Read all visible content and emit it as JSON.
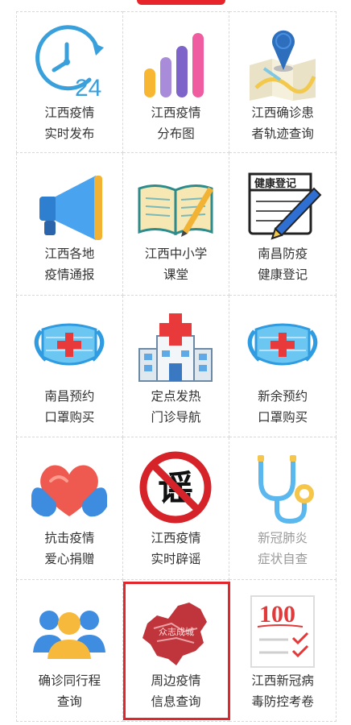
{
  "accent_color": "#e3262b",
  "tiles": [
    {
      "icon": "clock-24-icon",
      "line1": "江西疫情",
      "line2": "实时发布"
    },
    {
      "icon": "bar-chart-icon",
      "line1": "江西疫情",
      "line2": "分布图"
    },
    {
      "icon": "map-pin-icon",
      "line1": "江西确诊患",
      "line2": "者轨迹查询"
    },
    {
      "icon": "megaphone-icon",
      "line1": "江西各地",
      "line2": "疫情通报"
    },
    {
      "icon": "open-book-icon",
      "line1": "江西中小学",
      "line2": "课堂"
    },
    {
      "icon": "notebook-pen-icon",
      "line1": "南昌防疫",
      "line2": "健康登记",
      "note_text": "健康登记"
    },
    {
      "icon": "face-mask-icon",
      "line1": "南昌预约",
      "line2": "口罩购买"
    },
    {
      "icon": "hospital-icon",
      "line1": "定点发热",
      "line2": "门诊导航"
    },
    {
      "icon": "face-mask-icon",
      "line1": "新余预约",
      "line2": "口罩购买"
    },
    {
      "icon": "heart-hands-icon",
      "line1": "抗击疫情",
      "line2": "爱心捐赠"
    },
    {
      "icon": "no-rumor-icon",
      "line1": "江西疫情",
      "line2": "实时辟谣",
      "sign_text": "谣"
    },
    {
      "icon": "stethoscope-icon",
      "line1": "新冠肺炎",
      "line2": "症状自查"
    },
    {
      "icon": "people-group-icon",
      "line1": "确诊同行程",
      "line2": "查询"
    },
    {
      "icon": "china-map-icon",
      "line1": "周边疫情",
      "line2": "信息查询",
      "map_text": "众志成城"
    },
    {
      "icon": "score-paper-icon",
      "line1": "江西新冠病",
      "line2": "毒防控考卷",
      "score_text": "100"
    }
  ]
}
